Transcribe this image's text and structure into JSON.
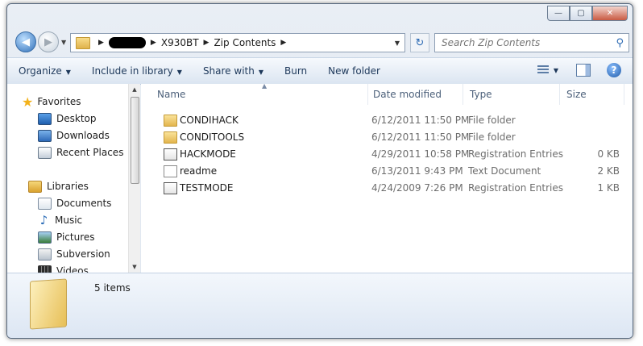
{
  "window": {
    "minimize_glyph": "—",
    "maximize_glyph": "▢",
    "close_glyph": "✕"
  },
  "nav": {
    "back_glyph": "◀",
    "forward_glyph": "▶",
    "dropdown_glyph": "▼"
  },
  "address": {
    "breadcrumbs": [
      "X930BT",
      "Zip Contents"
    ],
    "separator_glyph": "▶",
    "dropdown_glyph": "▼"
  },
  "refresh_glyph": "↻",
  "search": {
    "placeholder": "Search Zip Contents",
    "icon": "search-icon",
    "glyph": "⚲"
  },
  "toolbar": {
    "organize": "Organize",
    "include_in_library": "Include in library",
    "share_with": "Share with",
    "burn": "Burn",
    "new_folder": "New folder",
    "dropdown_glyph": "▼",
    "help_glyph": "?"
  },
  "sidebar": {
    "favorites": {
      "label": "Favorites",
      "items": [
        {
          "label": "Desktop",
          "icon": "desktop-icon"
        },
        {
          "label": "Downloads",
          "icon": "downloads-icon"
        },
        {
          "label": "Recent Places",
          "icon": "recent-places-icon"
        }
      ]
    },
    "libraries": {
      "label": "Libraries",
      "items": [
        {
          "label": "Documents",
          "icon": "documents-icon"
        },
        {
          "label": "Music",
          "icon": "music-icon"
        },
        {
          "label": "Pictures",
          "icon": "pictures-icon"
        },
        {
          "label": "Subversion",
          "icon": "subversion-icon"
        },
        {
          "label": "Videos",
          "icon": "videos-icon"
        }
      ]
    },
    "star_glyph": "★",
    "note_glyph": "♪",
    "scroll_up_glyph": "▲",
    "scroll_down_glyph": "▼"
  },
  "columns": {
    "name": "Name",
    "date_modified": "Date modified",
    "type": "Type",
    "size": "Size",
    "sort_glyph": "▲"
  },
  "files": [
    {
      "name": "CONDIHACK",
      "date": "6/12/2011 11:50 PM",
      "type": "File folder",
      "size": "",
      "icon": "folder-icon"
    },
    {
      "name": "CONDITOOLS",
      "date": "6/12/2011 11:50 PM",
      "type": "File folder",
      "size": "",
      "icon": "folder-icon"
    },
    {
      "name": "HACKMODE",
      "date": "4/29/2011 10:58 PM",
      "type": "Registration Entries",
      "size": "0 KB",
      "icon": "registry-file-icon"
    },
    {
      "name": "readme",
      "date": "6/13/2011 9:43 PM",
      "type": "Text Document",
      "size": "2 KB",
      "icon": "text-file-icon"
    },
    {
      "name": "TESTMODE",
      "date": "4/24/2009 7:26 PM",
      "type": "Registration Entries",
      "size": "1 KB",
      "icon": "registry-file-icon"
    }
  ],
  "details": {
    "item_count": "5 items"
  }
}
